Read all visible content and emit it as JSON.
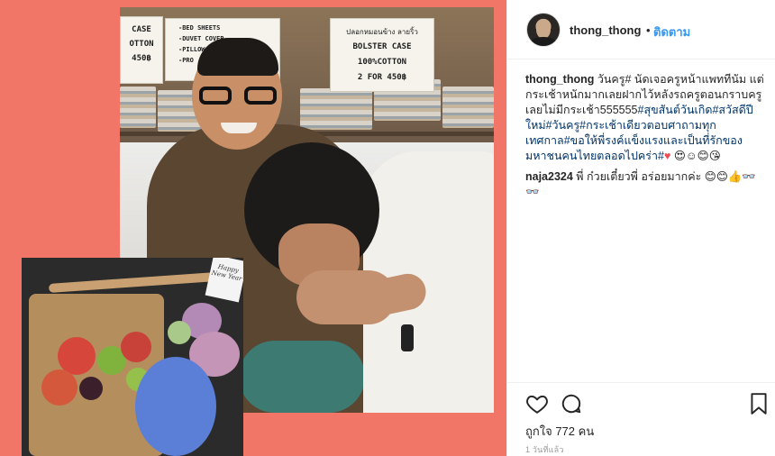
{
  "header": {
    "username": "thong_thong",
    "separator": "•",
    "follow_label": "ติดตาม"
  },
  "caption": {
    "username": "thong_thong",
    "text_1": " วันครู# นัดเจอครูหน้าแพททีนัม แต่กระเช้าหนักมากเลยฝากไว้หลังรถครูตอนกราบครูเลยไม่มีกระเช้า555555",
    "tags": "#สุขสันต์วันเกิด#สวัสดีปีใหม่#วันครู#กระเช้าเดียวตอบศาถามทุกเทศกาล#ขอให้พี่รงค์แข็งแรงและเป็นที่รักของมหาชนคนไทยตลอดไปคร่า#",
    "emoji_heart": "♥",
    "emoji_rest": " 😍☺😊😘"
  },
  "comment_1": {
    "username": "naja2324",
    "text": " พี่ ก๋วยเตี๋ยวพี่ อร่อยมากค่ะ 😊😊👍👓👓"
  },
  "photo_signs": {
    "left": "CASE\nOTTON\n450฿",
    "mid": "-BED SHEETS\n-DUVET COVER\n-PILLOW\n-PRO",
    "right_top": "ปลอกหมอนข้าง ลายริ้ว",
    "right_1": "BOLSTER CASE",
    "right_2": "100%COTTON",
    "right_3": "2 FOR 450฿",
    "card": "Happy New Year"
  },
  "icons": {
    "like": "heart-outline-icon",
    "comment": "speech-bubble-icon",
    "save": "bookmark-icon"
  },
  "likes_text": "ถูกใจ 772 คน",
  "timestamp": "1 วันที่แล้ว",
  "colors": {
    "frame_bg": "#f27668",
    "link_blue": "#3897f0",
    "hashtag": "#003569"
  }
}
